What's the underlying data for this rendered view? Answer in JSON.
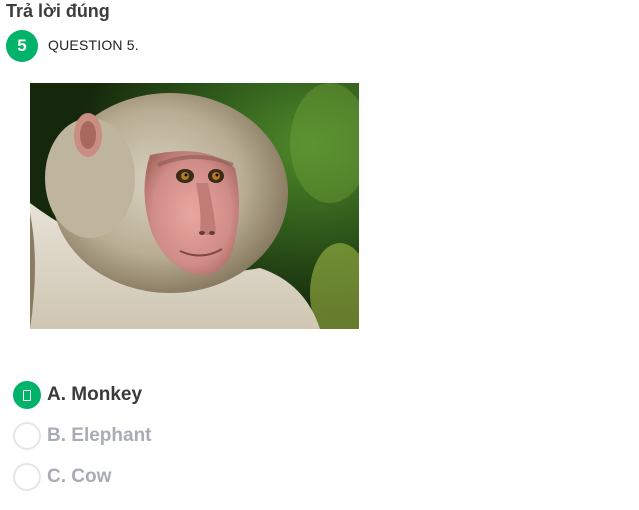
{
  "status": {
    "title": "Trả lời đúng"
  },
  "question": {
    "number": "5",
    "label": "QUESTION 5.",
    "image_subject": "monkey-photo"
  },
  "options": [
    {
      "text": "A. Monkey",
      "selected": true
    },
    {
      "text": "B. Elephant",
      "selected": false
    },
    {
      "text": "C. Cow",
      "selected": false
    }
  ],
  "colors": {
    "accent": "#00b368",
    "unselected_text": "#a9acb4",
    "radio_border": "#e6e6e6"
  }
}
